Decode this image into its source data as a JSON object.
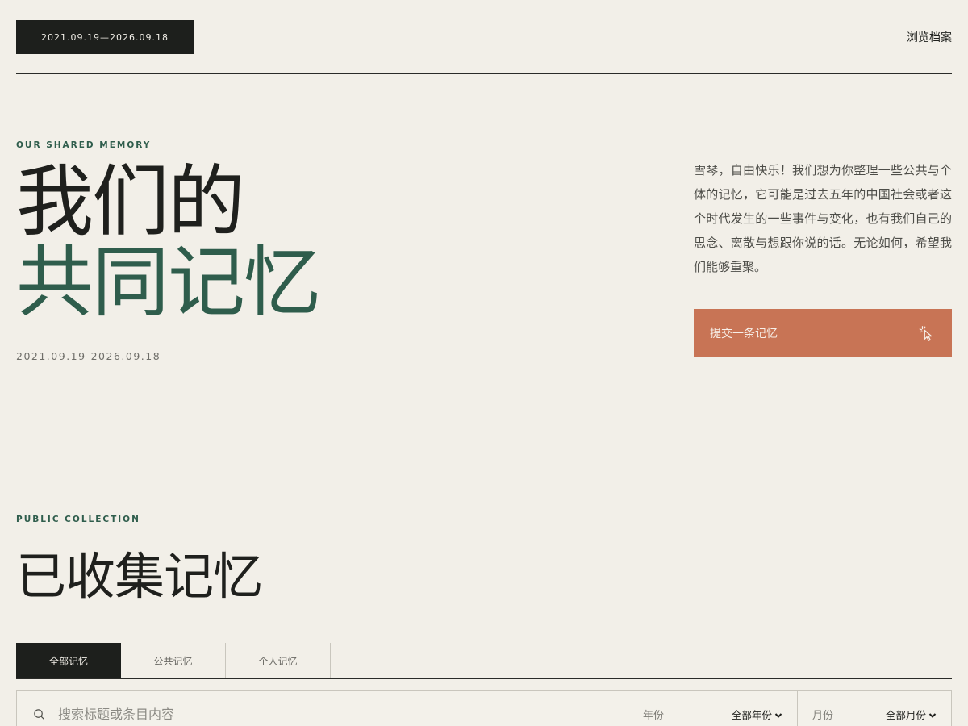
{
  "header": {
    "date_badge": "2021.09.19—2026.09.18",
    "browse_link": "浏览档案"
  },
  "hero": {
    "eyebrow": "OUR SHARED MEMORY",
    "title_line1": "我们的",
    "title_line2": "共同记忆",
    "date_range": "2021.09.19-2026.09.18",
    "description": "雪琴，自由快乐！我们想为你整理一些公共与个体的记忆，它可能是过去五年的中国社会或者这个时代发生的一些事件与变化，也有我们自己的思念、离散与想跟你说的话。无论如何，希望我们能够重聚。",
    "submit_button": "提交一条记忆",
    "submit_icon": "cursor-click-icon"
  },
  "collection": {
    "eyebrow": "PUBLIC COLLECTION",
    "title": "已收集记忆",
    "tabs": [
      {
        "label": "全部记忆",
        "active": true
      },
      {
        "label": "公共记忆",
        "active": false
      },
      {
        "label": "个人记忆",
        "active": false
      }
    ],
    "search": {
      "placeholder": "搜索标题或条目内容",
      "value": "",
      "icon": "search-icon"
    },
    "year_filter": {
      "label": "年份",
      "selected": "全部年份"
    },
    "month_filter": {
      "label": "月份",
      "selected": "全部月份"
    }
  },
  "colors": {
    "background": "#f2efe8",
    "ink": "#1d1f1c",
    "accent_green": "#2f5d4c",
    "accent_terracotta": "#c87455"
  }
}
